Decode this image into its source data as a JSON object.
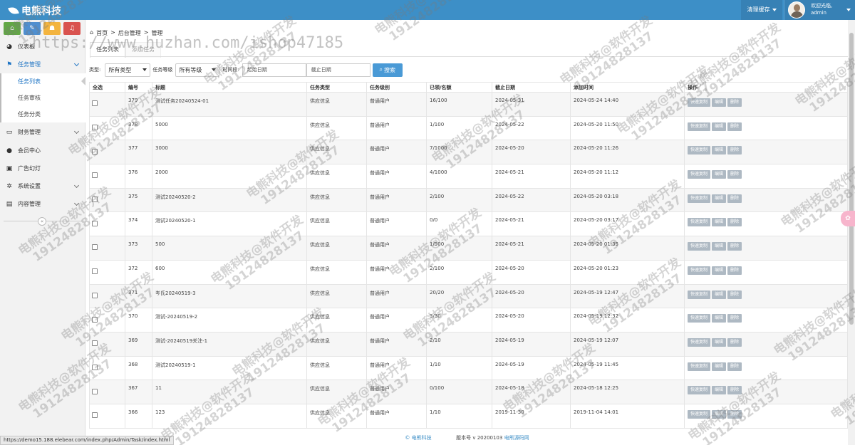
{
  "header": {
    "logo": "电熊科技",
    "clear_cache": "清理缓存",
    "welcome": "欢迎光临,",
    "user": "admin"
  },
  "sidebar": {
    "items": [
      {
        "label": "仪表板",
        "icon": "dashboard-icon"
      },
      {
        "label": "任务管理",
        "icon": "flag-icon",
        "active": true
      },
      {
        "label": "财务管理",
        "icon": "wallet-icon"
      },
      {
        "label": "会员中心",
        "icon": "user-icon"
      },
      {
        "label": "广告幻灯",
        "icon": "image-icon"
      },
      {
        "label": "系统设置",
        "icon": "gear-icon"
      },
      {
        "label": "内容管理",
        "icon": "book-icon"
      }
    ],
    "subitems": [
      "任务列表",
      "任务审核",
      "任务分类"
    ],
    "collapse": "«"
  },
  "breadcrumb": {
    "home": "首页",
    "sep": ">",
    "level2": "后台管理",
    "level3": "管理"
  },
  "tabs": [
    "任务列表",
    "添加任务"
  ],
  "filters": {
    "type_label": "类型:",
    "type_value": "所有类型",
    "level_label": "任务等级",
    "level_value": "所有等级",
    "time_label": "时间段:",
    "start_placeholder": "起始日期",
    "end_placeholder": "截止日期",
    "search": "搜索"
  },
  "table": {
    "headers": [
      "全选",
      "编号",
      "标题",
      "任务类型",
      "任务级别",
      "已领/名额",
      "截止日期",
      "添加时间",
      "操作"
    ],
    "actions": [
      "快速复制",
      "编辑",
      "删除"
    ],
    "rows": [
      [
        "379",
        "测试任务20240524-01",
        "供应信息",
        "普通用户",
        "16/100",
        "2024-05-31",
        "2024-05-24 14:40"
      ],
      [
        "378",
        "5000",
        "供应信息",
        "普通用户",
        "1/100",
        "2024-05-22",
        "2024-05-20 11:50"
      ],
      [
        "377",
        "3000",
        "供应信息",
        "普通用户",
        "7/1000",
        "2024-05-20",
        "2024-05-20 11:26"
      ],
      [
        "376",
        "2000",
        "供应信息",
        "普通用户",
        "4/1000",
        "2024-05-21",
        "2024-05-20 11:12"
      ],
      [
        "375",
        "测试20240520-2",
        "供应信息",
        "普通用户",
        "2/100",
        "2024-05-22",
        "2024-05-20 03:18"
      ],
      [
        "374",
        "测试20240520-1",
        "供应信息",
        "普通用户",
        "0/0",
        "2024-05-21",
        "2024-05-20 03:17"
      ],
      [
        "373",
        "500",
        "供应信息",
        "普通用户",
        "1/500",
        "2024-05-21",
        "2024-05-20 01:35"
      ],
      [
        "372",
        "600",
        "供应信息",
        "普通用户",
        "2/100",
        "2024-05-20",
        "2024-05-20 01:23"
      ],
      [
        "371",
        "岑氏20240519-3",
        "供应信息",
        "普通用户",
        "20/20",
        "2024-05-20",
        "2024-05-19 12:47"
      ],
      [
        "370",
        "测试-20240519-2",
        "供应信息",
        "普通用户",
        "3/30",
        "2024-05-20",
        "2024-05-19 12:32"
      ],
      [
        "369",
        "测试-20240519关注-1",
        "供应信息",
        "普通用户",
        "2/10",
        "2024-05-19",
        "2024-05-19 12:07"
      ],
      [
        "368",
        "测试20240519-1",
        "供应信息",
        "普通用户",
        "1/10",
        "2024-05-19",
        "2024-05-19 11:45"
      ],
      [
        "367",
        "11",
        "供应信息",
        "普通用户",
        "0/100",
        "2024-05-18",
        "2024-05-18 12:25"
      ],
      [
        "366",
        "123",
        "供应信息",
        "普通用户",
        "1/10",
        "2019-11-30",
        "2019-11-04 14:01"
      ]
    ]
  },
  "footer": {
    "brand": "© 电熊科技",
    "version": "版本号 v 20200103",
    "link": "电熊源码网"
  },
  "status_url": "https://demo15.188.elebear.com/index.php/Admin/Task/index.html",
  "watermark": {
    "url": "https://www.huzhan.com/ishop47185",
    "line1": "电熊科技@软件开发",
    "line2": "19124828137"
  }
}
